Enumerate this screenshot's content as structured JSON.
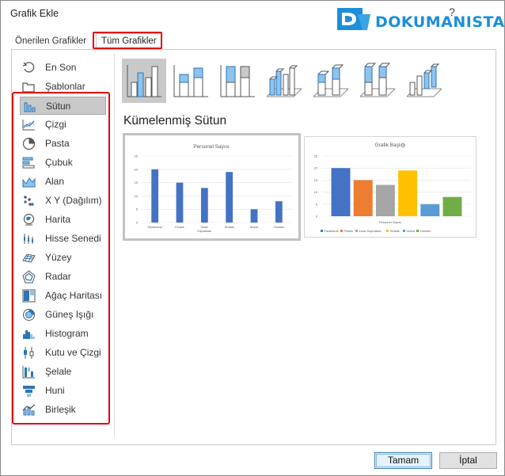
{
  "dialog": {
    "title": "Grafik Ekle",
    "help": "?"
  },
  "logo": {
    "text": "DOKUMANISTAN"
  },
  "tabs": [
    {
      "label": "Önerilen Grafikler",
      "selected": false
    },
    {
      "label": "Tüm Grafikler",
      "selected": true
    }
  ],
  "categories": [
    {
      "label": "En Son",
      "icon": "recent-icon"
    },
    {
      "label": "Şablonlar",
      "icon": "folder-icon"
    },
    {
      "label": "Sütun",
      "icon": "column-chart-icon",
      "selected": true
    },
    {
      "label": "Çizgi",
      "icon": "line-chart-icon"
    },
    {
      "label": "Pasta",
      "icon": "pie-chart-icon"
    },
    {
      "label": "Çubuk",
      "icon": "bar-chart-icon"
    },
    {
      "label": "Alan",
      "icon": "area-chart-icon"
    },
    {
      "label": "X Y (Dağılım)",
      "icon": "scatter-chart-icon"
    },
    {
      "label": "Harita",
      "icon": "map-chart-icon"
    },
    {
      "label": "Hisse Senedi",
      "icon": "stock-chart-icon"
    },
    {
      "label": "Yüzey",
      "icon": "surface-chart-icon"
    },
    {
      "label": "Radar",
      "icon": "radar-chart-icon"
    },
    {
      "label": "Ağaç Haritası",
      "icon": "treemap-chart-icon"
    },
    {
      "label": "Güneş Işığı",
      "icon": "sunburst-chart-icon"
    },
    {
      "label": "Histogram",
      "icon": "histogram-chart-icon"
    },
    {
      "label": "Kutu ve Çizgi",
      "icon": "box-whisker-chart-icon"
    },
    {
      "label": "Şelale",
      "icon": "waterfall-chart-icon"
    },
    {
      "label": "Huni",
      "icon": "funnel-chart-icon"
    },
    {
      "label": "Birleşik",
      "icon": "combo-chart-icon"
    }
  ],
  "subtypes": [
    {
      "icon": "clustered-column-icon",
      "selected": true
    },
    {
      "icon": "stacked-column-icon"
    },
    {
      "icon": "100-stacked-column-icon"
    },
    {
      "icon": "3d-clustered-column-icon"
    },
    {
      "icon": "3d-stacked-column-icon"
    },
    {
      "icon": "3d-100-stacked-column-icon"
    },
    {
      "icon": "3d-column-icon"
    }
  ],
  "selected_type_name": "Kümelenmiş Sütun",
  "colors": {
    "accent_red": "#e3000f",
    "bar_blue": "#4472c4",
    "series": [
      "#4472c4",
      "#ed7d31",
      "#a5a5a5",
      "#ffc000",
      "#5b9bd5",
      "#70ad47"
    ]
  },
  "chart_data": [
    {
      "type": "bar",
      "title": "Personel Sayısı",
      "categories": [
        "Pazarlama",
        "Finans",
        "İnsan Kaynakları",
        "Tedarik",
        "Hukuk",
        "Yönetim"
      ],
      "values": [
        20,
        15,
        13,
        19,
        5,
        8
      ],
      "ylim": [
        0,
        25
      ],
      "yticks": [
        0,
        5,
        10,
        15,
        20,
        25
      ],
      "grid": true,
      "legend": "none"
    },
    {
      "type": "bar",
      "title": "Grafik Başlığı",
      "xlabel": "Personel Sayısı",
      "series": [
        {
          "name": "Pazarlama",
          "values": [
            20
          ]
        },
        {
          "name": "Finans",
          "values": [
            15
          ]
        },
        {
          "name": "İnsan Kaynakları",
          "values": [
            13
          ]
        },
        {
          "name": "Tedarik",
          "values": [
            19
          ]
        },
        {
          "name": "Hukuk",
          "values": [
            5
          ]
        },
        {
          "name": "Yönetim",
          "values": [
            8
          ]
        }
      ],
      "ylim": [
        0,
        25
      ],
      "yticks": [
        0,
        5,
        10,
        15,
        20,
        25
      ],
      "grid": true,
      "legend": "bottom"
    }
  ],
  "buttons": {
    "ok": "Tamam",
    "cancel": "İptal"
  }
}
